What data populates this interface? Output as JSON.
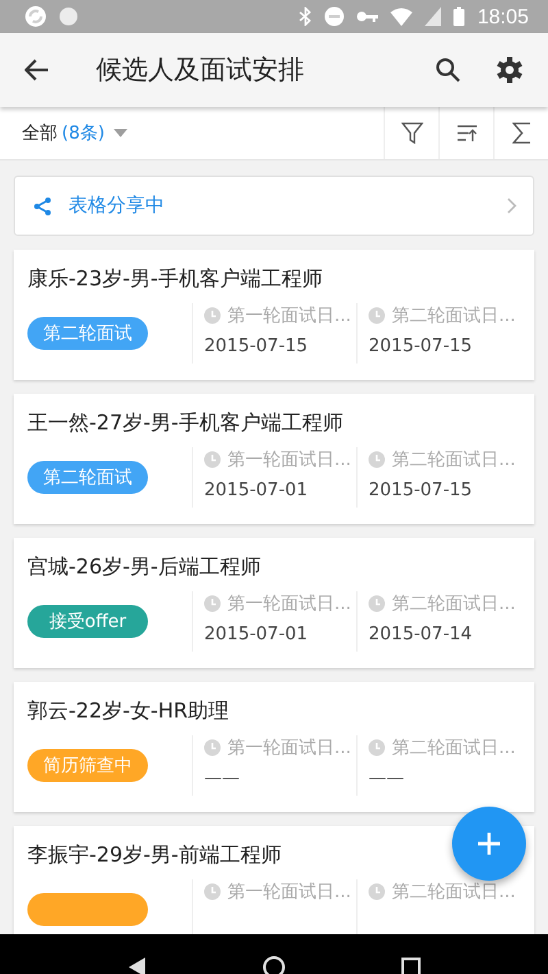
{
  "status_bar": {
    "time": "18:05"
  },
  "app_bar": {
    "title": "候选人及面试安排"
  },
  "filter_bar": {
    "scope": "全部",
    "count": "(8条)"
  },
  "share_banner": {
    "label": "表格分享中"
  },
  "candidates": [
    {
      "title": "康乐-23岁-男-手机客户端工程师",
      "status": "第二轮面试",
      "color": "#42a5f5",
      "dates": [
        {
          "label": "第一轮面试日...",
          "value": "2015-07-15"
        },
        {
          "label": "第二轮面试日...",
          "value": "2015-07-15"
        }
      ]
    },
    {
      "title": "王一然-27岁-男-手机客户端工程师",
      "status": "第二轮面试",
      "color": "#42a5f5",
      "dates": [
        {
          "label": "第一轮面试日...",
          "value": "2015-07-01"
        },
        {
          "label": "第二轮面试日...",
          "value": "2015-07-15"
        }
      ]
    },
    {
      "title": "宫城-26岁-男-后端工程师",
      "status": "接受offer",
      "color": "#26a69a",
      "dates": [
        {
          "label": "第一轮面试日...",
          "value": "2015-07-01"
        },
        {
          "label": "第二轮面试日...",
          "value": "2015-07-14"
        }
      ]
    },
    {
      "title": "郭云-22岁-女-HR助理",
      "status": "简历筛查中",
      "color": "#ffa726",
      "dates": [
        {
          "label": "第一轮面试日...",
          "value": "——"
        },
        {
          "label": "第二轮面试日...",
          "value": "——"
        }
      ]
    },
    {
      "title": "李振宇-29岁-男-前端工程师",
      "color": "#ffa726",
      "dates": [
        {
          "label": "第一轮面试日..."
        },
        {
          "label": "第二轮面试日..."
        }
      ]
    }
  ]
}
